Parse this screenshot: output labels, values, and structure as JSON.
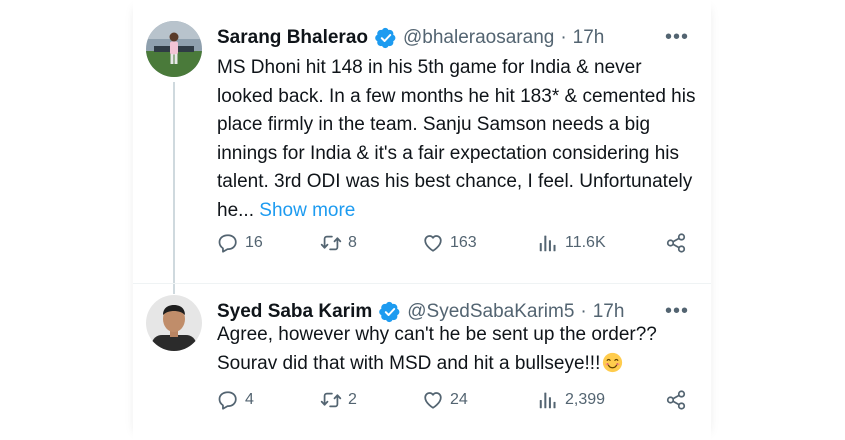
{
  "tweets": [
    {
      "name": "Sarang Bhalerao",
      "handle": "@bhaleraosarang",
      "separator": "·",
      "time": "17h",
      "text": "MS Dhoni hit 148 in his 5th game for India & never looked back. In a few months he hit 183* & cemented his place firmly in the team. Sanju Samson needs a big innings for India & it's a fair expectation considering his talent. 3rd ODI was his best chance, I feel. Unfortunately he...",
      "show_more": "Show more",
      "replies": "16",
      "retweets": "8",
      "likes": "163",
      "views": "11.6K"
    },
    {
      "name": "Syed Saba Karim",
      "handle": "@SyedSabaKarim5",
      "separator": "·",
      "time": "17h",
      "text": "Agree, however why can't he be sent up the order?? Sourav did that with MSD and hit a bullseye!!!",
      "emoji": "smiling-face-with-smiling-eyes",
      "replies": "4",
      "retweets": "2",
      "likes": "24",
      "views": "2,399"
    }
  ],
  "colors": {
    "text": "#0f1419",
    "secondary": "#536471",
    "accent": "#1d9bf0",
    "verified": "#1d9bf0",
    "thread_line": "#cfd9de"
  },
  "icons": [
    "more-icon",
    "verified-icon",
    "reply-icon",
    "retweet-icon",
    "like-icon",
    "views-icon",
    "share-icon"
  ]
}
